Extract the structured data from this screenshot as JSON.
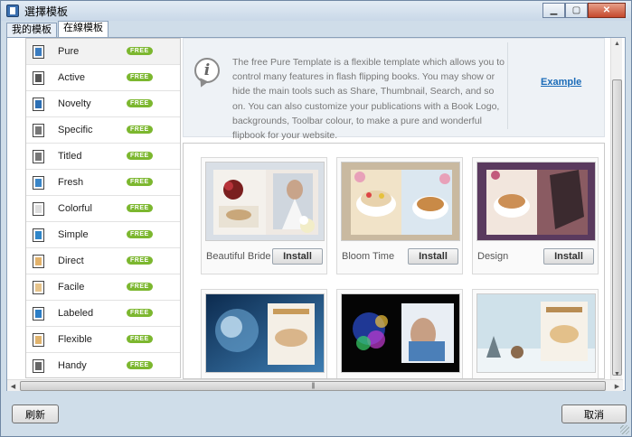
{
  "window": {
    "title": "選擇模板",
    "icon": "app-icon"
  },
  "tabs": [
    {
      "label": "我的模板",
      "active": false
    },
    {
      "label": "在線模板",
      "active": true
    }
  ],
  "sidebar": {
    "items": [
      {
        "label": "Pure",
        "badge": "FREE",
        "color": "#3a7cc0",
        "selected": true
      },
      {
        "label": "Active",
        "badge": "FREE",
        "color": "#555555"
      },
      {
        "label": "Novelty",
        "badge": "FREE",
        "color": "#2c6fb4"
      },
      {
        "label": "Specific",
        "badge": "FREE",
        "color": "#777777"
      },
      {
        "label": "Titled",
        "badge": "FREE",
        "color": "#777777"
      },
      {
        "label": "Fresh",
        "badge": "FREE",
        "color": "#3a86c8"
      },
      {
        "label": "Colorful",
        "badge": "FREE",
        "color": "#dddddd"
      },
      {
        "label": "Simple",
        "badge": "FREE",
        "color": "#2f86c9"
      },
      {
        "label": "Direct",
        "badge": "FREE",
        "color": "#e3b26a"
      },
      {
        "label": "Facile",
        "badge": "FREE",
        "color": "#e6c38a"
      },
      {
        "label": "Labeled",
        "badge": "FREE",
        "color": "#2c7ec6"
      },
      {
        "label": "Flexible",
        "badge": "FREE",
        "color": "#e0b36d"
      },
      {
        "label": "Handy",
        "badge": "FREE",
        "color": "#666666"
      }
    ]
  },
  "info": {
    "text": "The free Pure Template is a flexible template which allows you to control many features in flash flipping books. You may show or hide the main tools such as Share, Thumbnail, Search, and so on. You can also customize your publications with a Book Logo, backgrounds, Toolbar colour, to make a pure and wonderful flipbook for your website.",
    "example_label": "Example"
  },
  "gallery": {
    "cards": [
      {
        "name": "Beautiful Bride",
        "install_label": "Install"
      },
      {
        "name": "Bloom Time",
        "install_label": "Install"
      },
      {
        "name": "Design",
        "install_label": "Install"
      },
      {
        "name": "",
        "install_label": ""
      },
      {
        "name": "",
        "install_label": ""
      },
      {
        "name": "",
        "install_label": ""
      }
    ]
  },
  "footer": {
    "refresh_label": "刷新",
    "cancel_label": "取消"
  }
}
